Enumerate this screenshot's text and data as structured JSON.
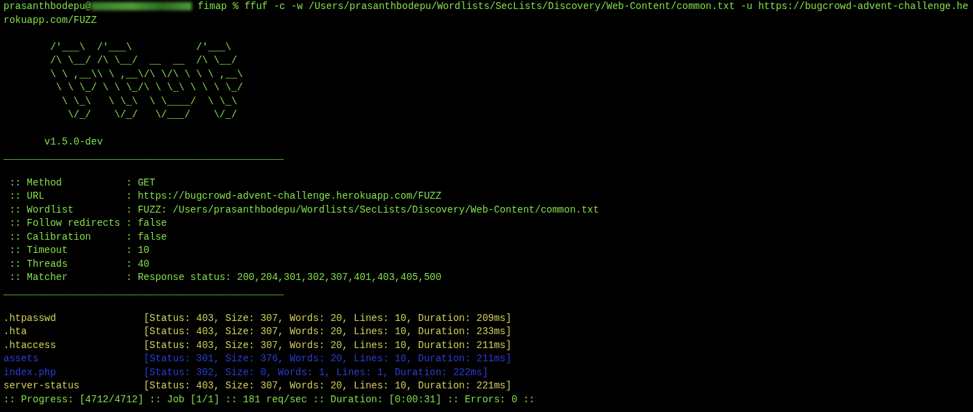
{
  "terminal": {
    "prompt_user": "prasanthbodepu@",
    "command": "fimap % ffuf -c -w /Users/prasanthbodepu/Wordlists/SecLists/Discovery/Web-Content/common.txt -u https://bugcrowd-advent-challenge.he",
    "command_wrapped": "rokuapp.com/FUZZ",
    "banner_art": [
      "/'___\\  /'___\\           /'___\\",
      "/\\ \\__/ /\\ \\__/  __  __  /\\ \\__/",
      "\\ \\ ,__\\\\ \\ ,__\\/\\ \\/\\ \\ \\ \\ ,__\\",
      " \\ \\ \\_/ \\ \\ \\_/\\ \\ \\_\\ \\ \\ \\ \\_/",
      "  \\ \\_\\   \\ \\_\\  \\ \\____/  \\ \\_\\",
      "   \\/_/    \\/_/   \\/___/    \\/_/"
    ],
    "version": "v1.5.0-dev",
    "separator": "________________________________________________",
    "config": [
      {
        "label": ":: Method",
        "value": ": GET"
      },
      {
        "label": ":: URL",
        "value": ": https://bugcrowd-advent-challenge.herokuapp.com/FUZZ"
      },
      {
        "label": ":: Wordlist",
        "value": ": FUZZ: /Users/prasanthbodepu/Wordlists/SecLists/Discovery/Web-Content/common.txt"
      },
      {
        "label": ":: Follow redirects",
        "value": ": false"
      },
      {
        "label": ":: Calibration",
        "value": ": false"
      },
      {
        "label": ":: Timeout",
        "value": ": 10"
      },
      {
        "label": ":: Threads",
        "value": ": 40"
      },
      {
        "label": ":: Matcher",
        "value": ": Response status: 200,204,301,302,307,401,403,405,500"
      }
    ],
    "separator_2": "________________________________________________",
    "results": [
      {
        "name": ".htpasswd",
        "details": "[Status: 403, Size: 307, Words: 20, Lines: 10, Duration: 209ms]",
        "color": "#d2d25c"
      },
      {
        "name": ".hta",
        "details": "[Status: 403, Size: 307, Words: 20, Lines: 10, Duration: 233ms]",
        "color": "#d2d25c"
      },
      {
        "name": ".htaccess",
        "details": "[Status: 403, Size: 307, Words: 20, Lines: 10, Duration: 211ms]",
        "color": "#d2d25c"
      },
      {
        "name": "assets",
        "details": "[Status: 301, Size: 376, Words: 20, Lines: 10, Duration: 211ms]",
        "color": "#2a3ed6"
      },
      {
        "name": "index.php",
        "details": "[Status: 302, Size: 0, Words: 1, Lines: 1, Duration: 222ms]",
        "color": "#2a3ed6"
      },
      {
        "name": "server-status",
        "details": "[Status: 403, Size: 307, Words: 20, Lines: 10, Duration: 221ms]",
        "color": "#d2d25c"
      }
    ],
    "progress": ":: Progress: [4712/4712] :: Job [1/1] :: 181 req/sec :: Duration: [0:00:31] :: Errors: 0 ::"
  }
}
